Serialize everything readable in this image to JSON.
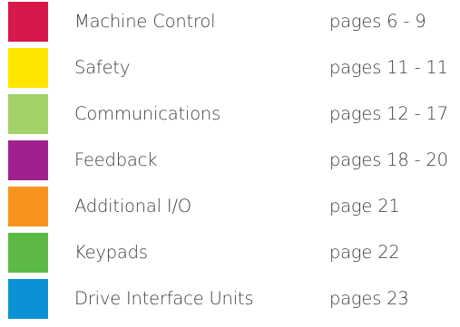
{
  "legend": {
    "items": [
      {
        "label": "Machine Control",
        "pages": "pages 6 - 9",
        "color": "#d8174b"
      },
      {
        "label": "Safety",
        "pages": "pages 11 - 11",
        "color": "#ffe500"
      },
      {
        "label": "Communications",
        "pages": "pages 12 - 17",
        "color": "#a3d16a"
      },
      {
        "label": "Feedback",
        "pages": "pages 18 - 20",
        "color": "#a0208d"
      },
      {
        "label": "Additional I/O",
        "pages": "page 21",
        "color": "#f7941e"
      },
      {
        "label": "Keypads",
        "pages": "page 22",
        "color": "#5cb946"
      },
      {
        "label": "Drive Interface Units",
        "pages": "pages 23",
        "color": "#0b92d6"
      }
    ]
  }
}
